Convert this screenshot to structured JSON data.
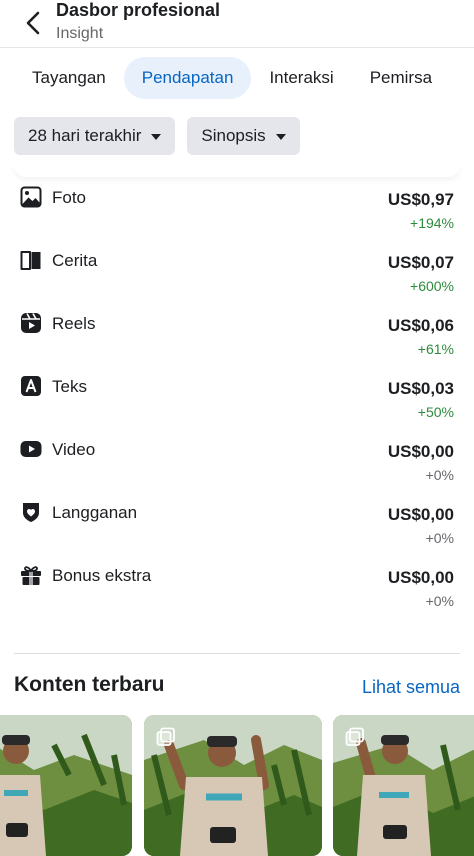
{
  "header": {
    "title": "Dasbor profesional",
    "subtitle": "Insight"
  },
  "tabs": [
    {
      "label": "Tayangan",
      "active": false
    },
    {
      "label": "Pendapatan",
      "active": true
    },
    {
      "label": "Interaksi",
      "active": false
    },
    {
      "label": "Pemirsa",
      "active": false
    }
  ],
  "filters": {
    "period": "28 hari terakhir",
    "view": "Sinopsis"
  },
  "earnings": [
    {
      "icon": "photo-icon",
      "label": "Foto",
      "value": "US$0,97",
      "change": "+194%",
      "trend": "positive"
    },
    {
      "icon": "story-icon",
      "label": "Cerita",
      "value": "US$0,07",
      "change": "+600%",
      "trend": "positive"
    },
    {
      "icon": "reels-icon",
      "label": "Reels",
      "value": "US$0,06",
      "change": "+61%",
      "trend": "positive"
    },
    {
      "icon": "text-icon",
      "label": "Teks",
      "value": "US$0,03",
      "change": "+50%",
      "trend": "positive"
    },
    {
      "icon": "video-icon",
      "label": "Video",
      "value": "US$0,00",
      "change": "+0%",
      "trend": "neutral"
    },
    {
      "icon": "subscription-icon",
      "label": "Langganan",
      "value": "US$0,00",
      "change": "+0%",
      "trend": "neutral"
    },
    {
      "icon": "gift-icon",
      "label": "Bonus ekstra",
      "value": "US$0,00",
      "change": "+0%",
      "trend": "neutral"
    }
  ],
  "recent": {
    "title": "Konten terbaru",
    "see_all": "Lihat semua"
  },
  "colors": {
    "accent": "#0866c2",
    "positive": "#2e8b3d",
    "active_tab_bg": "#e7f0fb",
    "chip_bg": "#e4e6eb"
  }
}
